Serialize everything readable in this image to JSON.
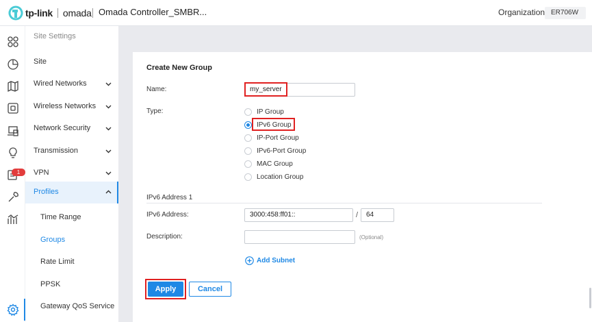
{
  "header": {
    "brand_primary": "tp-link",
    "brand_secondary": "omada",
    "controller_title": "Omada Controller_SMBR...",
    "org_label": "Organization:",
    "org_value": "ER706W"
  },
  "iconbar": {
    "icons": [
      "dashboard-icon",
      "statistics-icon",
      "map-icon",
      "devices-icon",
      "clients-icon",
      "insight-icon",
      "log-icon",
      "tools-icon",
      "reports-icon",
      "settings-icon"
    ],
    "log_badge": "1"
  },
  "sidebar": {
    "heading": "Site Settings",
    "items": [
      {
        "label": "Site",
        "chevron": ""
      },
      {
        "label": "Wired Networks",
        "chevron": "down"
      },
      {
        "label": "Wireless Networks",
        "chevron": "down"
      },
      {
        "label": "Network Security",
        "chevron": "down"
      },
      {
        "label": "Transmission",
        "chevron": "down"
      },
      {
        "label": "VPN",
        "chevron": "down"
      },
      {
        "label": "Profiles",
        "chevron": "up"
      }
    ],
    "sub_items": [
      {
        "label": "Time Range"
      },
      {
        "label": "Groups"
      },
      {
        "label": "Rate Limit"
      },
      {
        "label": "PPSK"
      },
      {
        "label": "Gateway QoS Service"
      }
    ],
    "active_item": "Profiles",
    "selected_sub_item": "Groups"
  },
  "form": {
    "title": "Create New Group",
    "name_label": "Name:",
    "name_value": "my_server",
    "type_label": "Type:",
    "type_options": [
      "IP Group",
      "IPv6 Group",
      "IP-Port Group",
      "IPv6-Port Group",
      "MAC Group",
      "Location Group"
    ],
    "type_selected": "IPv6 Group",
    "section_title": "IPv6 Address 1",
    "ipv6_label": "IPv6 Address:",
    "ipv6_value": "3000:458:ff01::",
    "prefix_separator": "/",
    "prefix_value": "64",
    "description_label": "Description:",
    "description_value": "",
    "description_hint": "(Optional)",
    "add_subnet_label": "Add Subnet",
    "apply_label": "Apply",
    "cancel_label": "Cancel"
  },
  "colors": {
    "accent": "#1e88e5",
    "highlight": "#e02020",
    "badge": "#e23c3c"
  }
}
